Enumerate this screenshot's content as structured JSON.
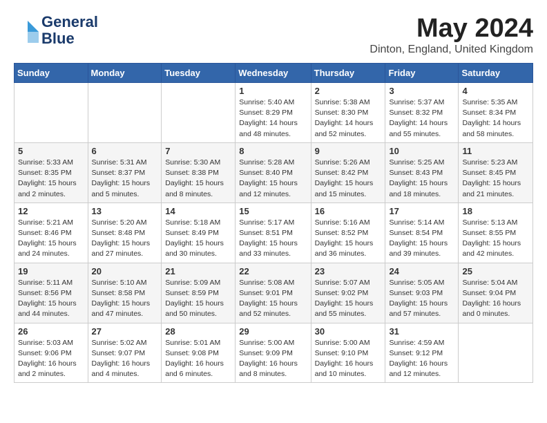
{
  "header": {
    "logo_line1": "General",
    "logo_line2": "Blue",
    "month": "May 2024",
    "location": "Dinton, England, United Kingdom"
  },
  "weekdays": [
    "Sunday",
    "Monday",
    "Tuesday",
    "Wednesday",
    "Thursday",
    "Friday",
    "Saturday"
  ],
  "weeks": [
    [
      {
        "day": "",
        "info": ""
      },
      {
        "day": "",
        "info": ""
      },
      {
        "day": "",
        "info": ""
      },
      {
        "day": "1",
        "info": "Sunrise: 5:40 AM\nSunset: 8:29 PM\nDaylight: 14 hours\nand 48 minutes."
      },
      {
        "day": "2",
        "info": "Sunrise: 5:38 AM\nSunset: 8:30 PM\nDaylight: 14 hours\nand 52 minutes."
      },
      {
        "day": "3",
        "info": "Sunrise: 5:37 AM\nSunset: 8:32 PM\nDaylight: 14 hours\nand 55 minutes."
      },
      {
        "day": "4",
        "info": "Sunrise: 5:35 AM\nSunset: 8:34 PM\nDaylight: 14 hours\nand 58 minutes."
      }
    ],
    [
      {
        "day": "5",
        "info": "Sunrise: 5:33 AM\nSunset: 8:35 PM\nDaylight: 15 hours\nand 2 minutes."
      },
      {
        "day": "6",
        "info": "Sunrise: 5:31 AM\nSunset: 8:37 PM\nDaylight: 15 hours\nand 5 minutes."
      },
      {
        "day": "7",
        "info": "Sunrise: 5:30 AM\nSunset: 8:38 PM\nDaylight: 15 hours\nand 8 minutes."
      },
      {
        "day": "8",
        "info": "Sunrise: 5:28 AM\nSunset: 8:40 PM\nDaylight: 15 hours\nand 12 minutes."
      },
      {
        "day": "9",
        "info": "Sunrise: 5:26 AM\nSunset: 8:42 PM\nDaylight: 15 hours\nand 15 minutes."
      },
      {
        "day": "10",
        "info": "Sunrise: 5:25 AM\nSunset: 8:43 PM\nDaylight: 15 hours\nand 18 minutes."
      },
      {
        "day": "11",
        "info": "Sunrise: 5:23 AM\nSunset: 8:45 PM\nDaylight: 15 hours\nand 21 minutes."
      }
    ],
    [
      {
        "day": "12",
        "info": "Sunrise: 5:21 AM\nSunset: 8:46 PM\nDaylight: 15 hours\nand 24 minutes."
      },
      {
        "day": "13",
        "info": "Sunrise: 5:20 AM\nSunset: 8:48 PM\nDaylight: 15 hours\nand 27 minutes."
      },
      {
        "day": "14",
        "info": "Sunrise: 5:18 AM\nSunset: 8:49 PM\nDaylight: 15 hours\nand 30 minutes."
      },
      {
        "day": "15",
        "info": "Sunrise: 5:17 AM\nSunset: 8:51 PM\nDaylight: 15 hours\nand 33 minutes."
      },
      {
        "day": "16",
        "info": "Sunrise: 5:16 AM\nSunset: 8:52 PM\nDaylight: 15 hours\nand 36 minutes."
      },
      {
        "day": "17",
        "info": "Sunrise: 5:14 AM\nSunset: 8:54 PM\nDaylight: 15 hours\nand 39 minutes."
      },
      {
        "day": "18",
        "info": "Sunrise: 5:13 AM\nSunset: 8:55 PM\nDaylight: 15 hours\nand 42 minutes."
      }
    ],
    [
      {
        "day": "19",
        "info": "Sunrise: 5:11 AM\nSunset: 8:56 PM\nDaylight: 15 hours\nand 44 minutes."
      },
      {
        "day": "20",
        "info": "Sunrise: 5:10 AM\nSunset: 8:58 PM\nDaylight: 15 hours\nand 47 minutes."
      },
      {
        "day": "21",
        "info": "Sunrise: 5:09 AM\nSunset: 8:59 PM\nDaylight: 15 hours\nand 50 minutes."
      },
      {
        "day": "22",
        "info": "Sunrise: 5:08 AM\nSunset: 9:01 PM\nDaylight: 15 hours\nand 52 minutes."
      },
      {
        "day": "23",
        "info": "Sunrise: 5:07 AM\nSunset: 9:02 PM\nDaylight: 15 hours\nand 55 minutes."
      },
      {
        "day": "24",
        "info": "Sunrise: 5:05 AM\nSunset: 9:03 PM\nDaylight: 15 hours\nand 57 minutes."
      },
      {
        "day": "25",
        "info": "Sunrise: 5:04 AM\nSunset: 9:04 PM\nDaylight: 16 hours\nand 0 minutes."
      }
    ],
    [
      {
        "day": "26",
        "info": "Sunrise: 5:03 AM\nSunset: 9:06 PM\nDaylight: 16 hours\nand 2 minutes."
      },
      {
        "day": "27",
        "info": "Sunrise: 5:02 AM\nSunset: 9:07 PM\nDaylight: 16 hours\nand 4 minutes."
      },
      {
        "day": "28",
        "info": "Sunrise: 5:01 AM\nSunset: 9:08 PM\nDaylight: 16 hours\nand 6 minutes."
      },
      {
        "day": "29",
        "info": "Sunrise: 5:00 AM\nSunset: 9:09 PM\nDaylight: 16 hours\nand 8 minutes."
      },
      {
        "day": "30",
        "info": "Sunrise: 5:00 AM\nSunset: 9:10 PM\nDaylight: 16 hours\nand 10 minutes."
      },
      {
        "day": "31",
        "info": "Sunrise: 4:59 AM\nSunset: 9:12 PM\nDaylight: 16 hours\nand 12 minutes."
      },
      {
        "day": "",
        "info": ""
      }
    ]
  ]
}
